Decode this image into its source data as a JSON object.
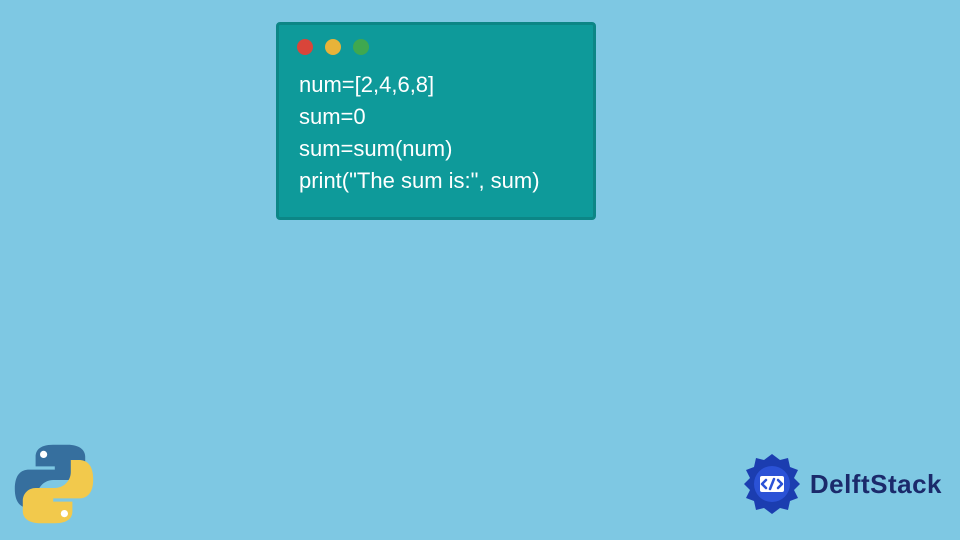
{
  "code": {
    "lines": [
      "num=[2,4,6,8]",
      "sum=0",
      "sum=sum(num)",
      "print(\"The sum is:\", sum)"
    ]
  },
  "branding": {
    "name": "DelftStack"
  }
}
